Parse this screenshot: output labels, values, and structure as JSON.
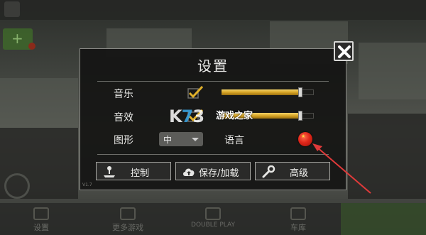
{
  "dialog": {
    "title": "设置",
    "music_label": "音乐",
    "sfx_label": "音效",
    "graphics_label": "图形",
    "graphics_value": "中",
    "language_label": "语言",
    "music_enabled": true,
    "sfx_enabled": true,
    "music_volume": 0.85,
    "sfx_volume": 0.85,
    "version": "V1.7",
    "buttons": {
      "controls": "控制",
      "save_load": "保存/加载",
      "advanced": "高级"
    }
  },
  "background": {
    "bottom_nav": [
      "设置",
      "更多游戏",
      "DOUBLE PLAY",
      "车库"
    ]
  },
  "watermark": {
    "logo": "K73",
    "text": "游戏之家"
  },
  "icons": {
    "close": "close-icon",
    "check": "checkmark-icon",
    "joystick": "joystick-icon",
    "cloud": "cloud-upload-icon",
    "wrench": "wrench-icon",
    "flag": "china-flag-icon"
  },
  "colors": {
    "slider_fill": "#d7a526",
    "annotation_arrow": "#e03a3a",
    "flag": "#e0261a"
  }
}
